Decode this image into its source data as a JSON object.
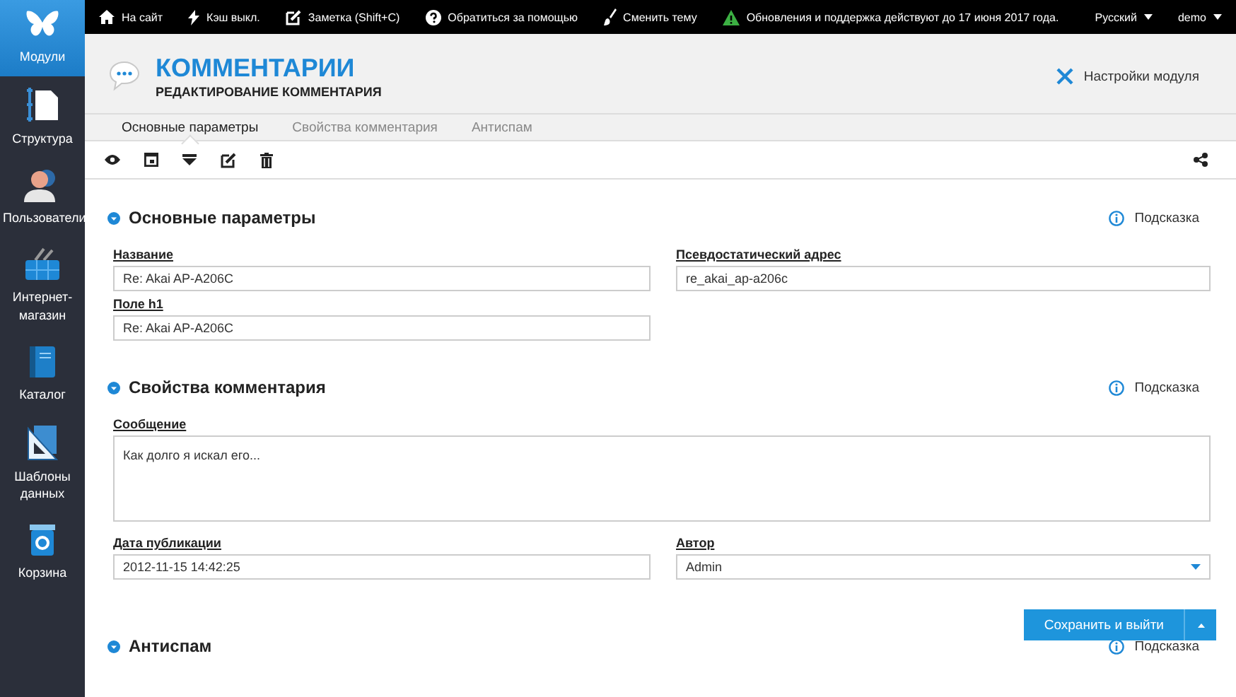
{
  "sidebar": {
    "items": [
      {
        "label": "Модули",
        "selected": true
      },
      {
        "label": "Структура",
        "selected": false
      },
      {
        "label": "Пользователи",
        "selected": false
      },
      {
        "label": "Интернет-магазин",
        "selected": false
      },
      {
        "label": "Каталог",
        "selected": false
      },
      {
        "label": "Шаблоны данных",
        "selected": false
      },
      {
        "label": "Корзина",
        "selected": false
      }
    ]
  },
  "topbar": {
    "items": [
      {
        "label": "На сайт"
      },
      {
        "label": "Кэш выкл."
      },
      {
        "label": "Заметка (Shift+C)"
      },
      {
        "label": "Обратиться за помощью"
      },
      {
        "label": "Сменить тему"
      },
      {
        "label": "Обновления и поддержка действуют до 17 июня 2017 года."
      }
    ],
    "language": "Русский",
    "user": "demo"
  },
  "header": {
    "title": "КОММЕНТАРИИ",
    "subtitle": "РЕДАКТИРОВАНИЕ КОММЕНТАРИЯ",
    "settings": "Настройки модуля"
  },
  "tabs": [
    {
      "label": "Основные параметры",
      "selected": true
    },
    {
      "label": "Свойства комментария",
      "selected": false
    },
    {
      "label": "Антиспам",
      "selected": false
    }
  ],
  "sections": [
    {
      "title": "Основные параметры",
      "hint": "Подсказка",
      "rows": [
        [
          {
            "label": "Название",
            "kind": "text",
            "value": "Re: Akai AP-A206C"
          },
          {
            "label": "Псевдостатический адрес",
            "kind": "text",
            "value": "re_akai_ap-a206c"
          }
        ],
        [
          {
            "label": "Поле h1",
            "kind": "text",
            "value": "Re: Akai AP-A206C"
          }
        ]
      ]
    },
    {
      "title": "Свойства комментария",
      "hint": "Подсказка",
      "rows": [
        [
          {
            "label": "Сообщение",
            "kind": "textarea",
            "value": "Как долго я искал его..."
          }
        ],
        [
          {
            "label": "Дата публикации",
            "kind": "text",
            "value": "2012-11-15 14:42:25"
          },
          {
            "label": "Автор",
            "kind": "select",
            "value": "Admin"
          }
        ]
      ]
    },
    {
      "title": "Антиспам",
      "hint": "Подсказка"
    }
  ],
  "save_button": "Сохранить и выйти"
}
